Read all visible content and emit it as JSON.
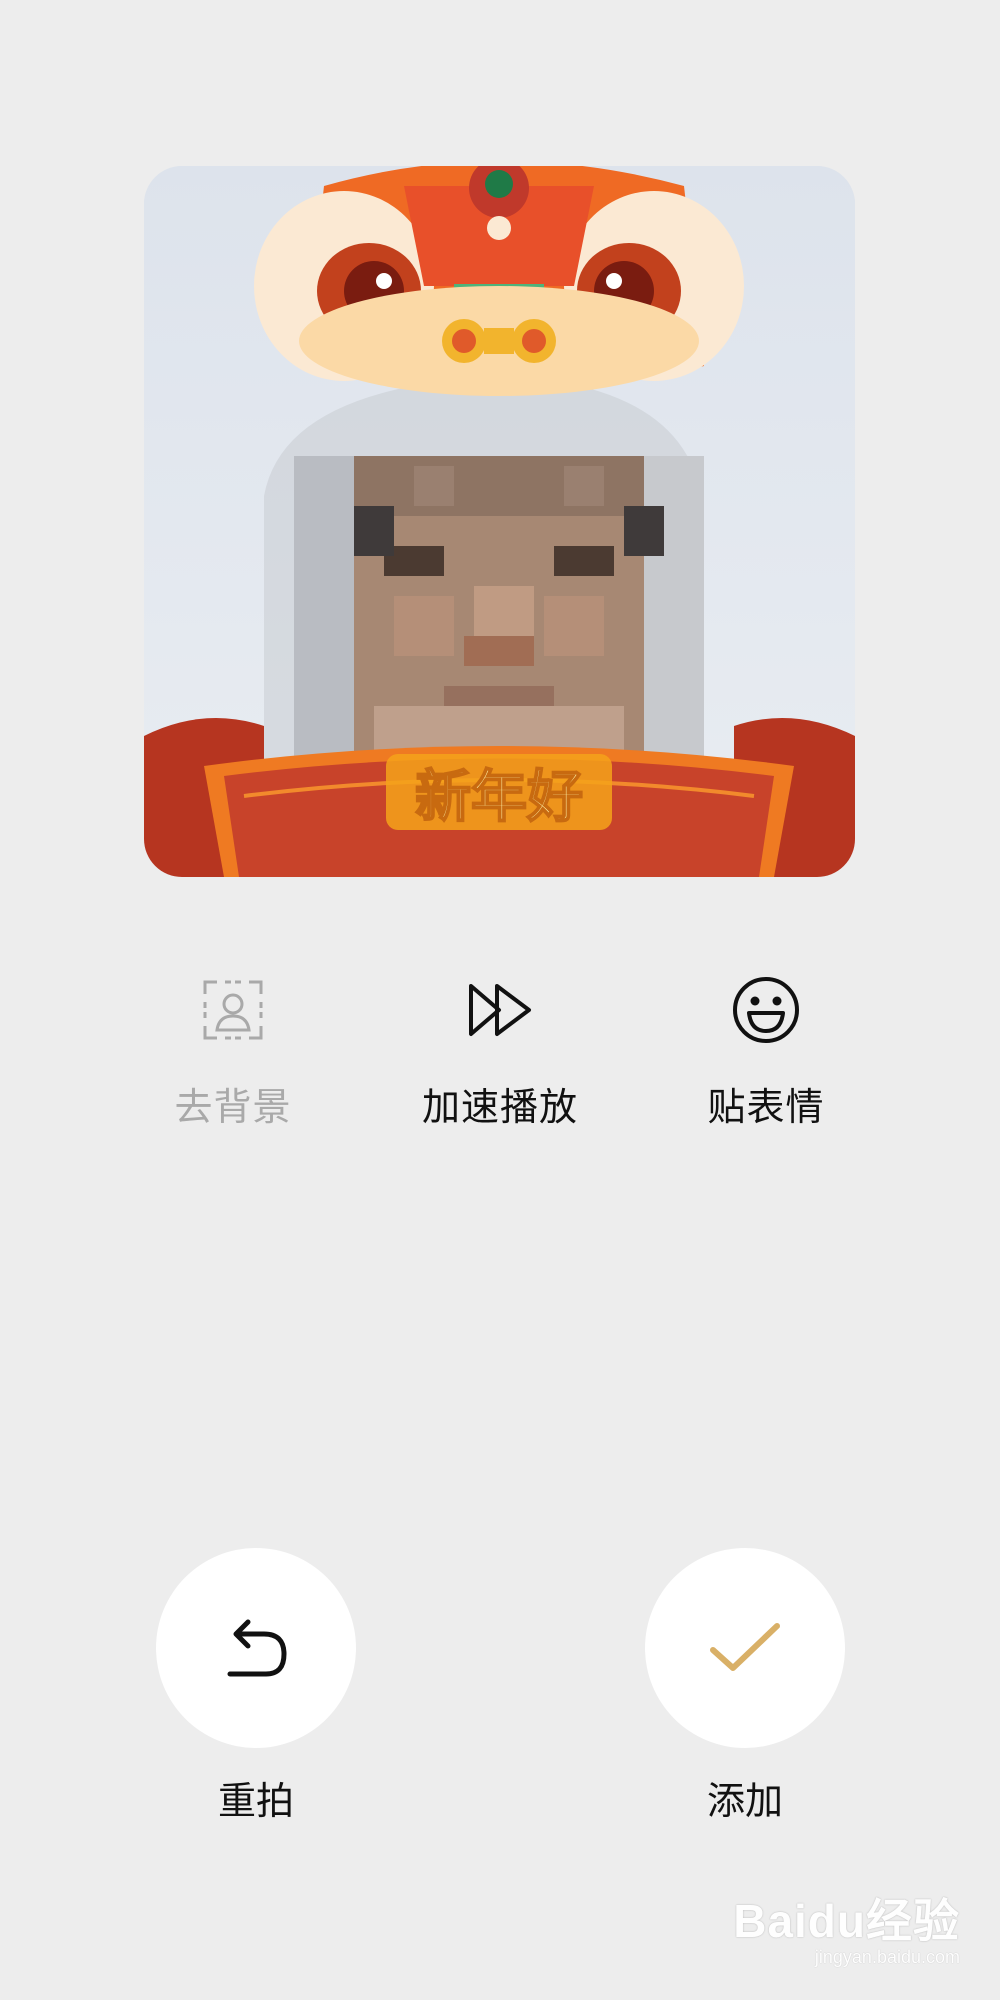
{
  "preview": {
    "banner_text": "新年好"
  },
  "tools": [
    {
      "label": "去背景",
      "icon": "remove-background-icon",
      "enabled": false
    },
    {
      "label": "加速播放",
      "icon": "fast-forward-icon",
      "enabled": true
    },
    {
      "label": "贴表情",
      "icon": "smiley-face-icon",
      "enabled": true
    }
  ],
  "actions": {
    "retake_label": "重拍",
    "retake_icon": "undo-arrow-icon",
    "add_label": "添加",
    "add_icon": "checkmark-icon"
  },
  "colors": {
    "background": "#ededed",
    "button_bg": "#ffffff",
    "check_gold": "#d9b067",
    "disabled_text": "#a9a9a9",
    "banner_red": "#c8432a",
    "lion_orange": "#ef6a24"
  },
  "watermark": {
    "text": "Baidu经验",
    "subtext": "jingyan.baidu.com"
  }
}
